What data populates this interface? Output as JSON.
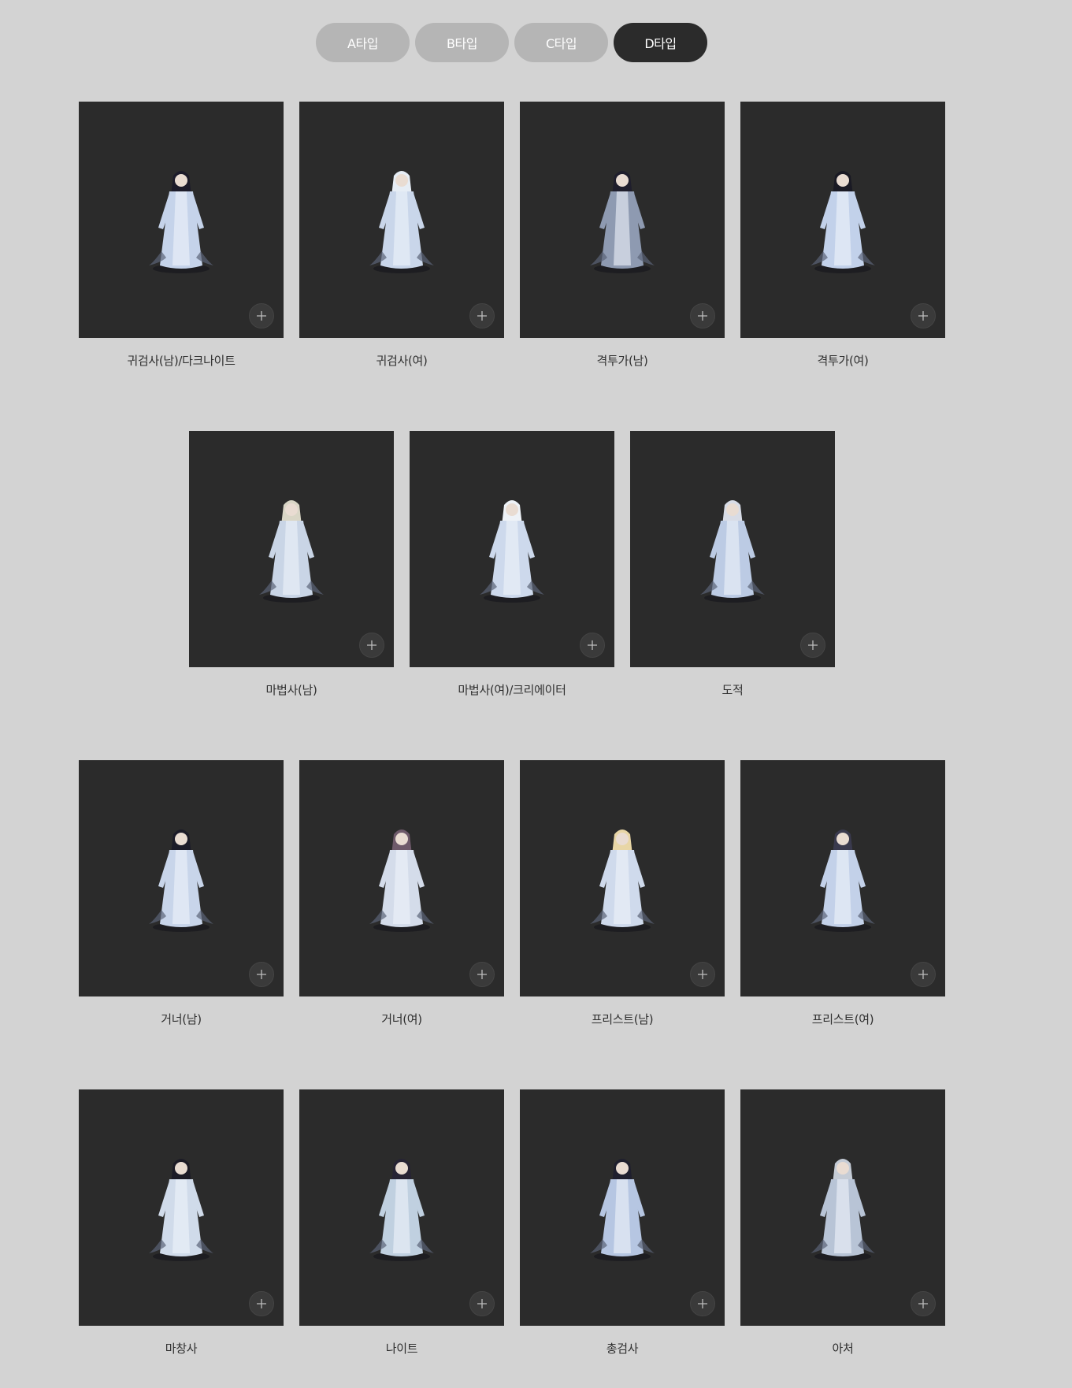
{
  "tabs": [
    {
      "label": "A타입",
      "active": false
    },
    {
      "label": "B타입",
      "active": false
    },
    {
      "label": "C타입",
      "active": false
    },
    {
      "label": "D타입",
      "active": true
    }
  ],
  "cards": [
    {
      "label": "귀검사(남)/다크나이트",
      "hair": "#1c1b2a",
      "robe": "#c5d3ea"
    },
    {
      "label": "귀검사(여)",
      "hair": "#e6edf5",
      "robe": "#c9d6ea"
    },
    {
      "label": "격투가(남)",
      "hair": "#1f1e2c",
      "robe": "#8e9ab1"
    },
    {
      "label": "격투가(여)",
      "hair": "#1a1a24",
      "robe": "#c2d1ea"
    },
    {
      "label": "마법사(남)",
      "hair": "#d9d6c6",
      "robe": "#c9d5e6"
    },
    {
      "label": "마법사(여)/크리에이터",
      "hair": "#eef2f7",
      "robe": "#cdd9ec"
    },
    {
      "label": "도적",
      "hair": "#d8dce6",
      "robe": "#bccbe4"
    },
    {
      "label": "거너(남)",
      "hair": "#1b1b28",
      "robe": "#c8d5ea"
    },
    {
      "label": "거너(여)",
      "hair": "#6e5a6a",
      "robe": "#d4dcea"
    },
    {
      "label": "프리스트(남)",
      "hair": "#e8d6a6",
      "robe": "#cfdaec"
    },
    {
      "label": "프리스트(여)",
      "hair": "#3a3a4e",
      "robe": "#c3d1e9"
    },
    {
      "label": "마창사",
      "hair": "#1c1b26",
      "robe": "#d0dbea"
    },
    {
      "label": "나이트",
      "hair": "#262334",
      "robe": "#c0d0e0"
    },
    {
      "label": "총검사",
      "hair": "#1f1f2e",
      "robe": "#b6c6e2"
    },
    {
      "label": "아처",
      "hair": "#c5ccd6",
      "robe": "#b8c4d6"
    }
  ]
}
